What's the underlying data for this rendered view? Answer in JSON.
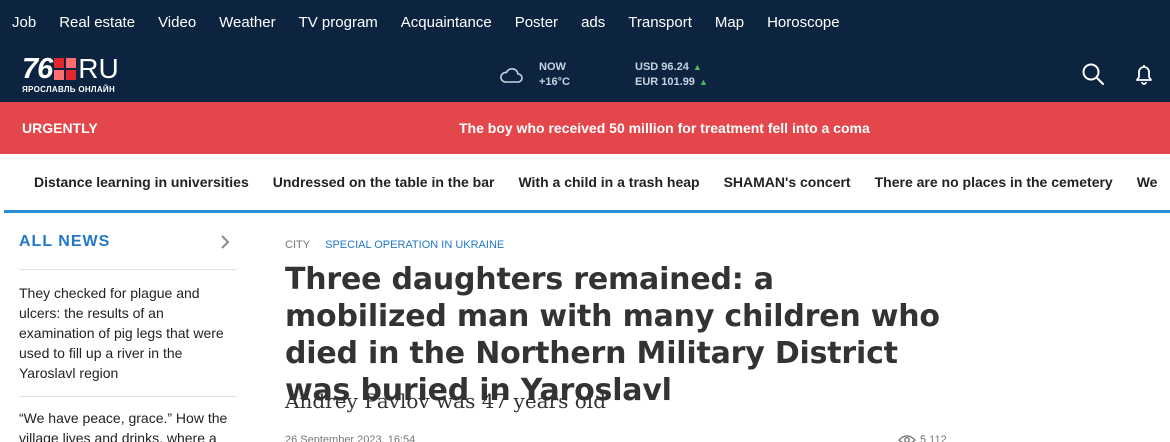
{
  "topnav": [
    "Job",
    "Real estate",
    "Video",
    "Weather",
    "TV program",
    "Acquaintance",
    "Poster",
    "ads",
    "Transport",
    "Map",
    "Horoscope"
  ],
  "logo": {
    "number": "76",
    "suffix": "RU",
    "subtitle": "ЯРОСЛАВЛЬ ОНЛАЙН"
  },
  "weather": {
    "label": "NOW",
    "temp": "+16°C",
    "icon": "cloud-icon"
  },
  "currency": {
    "usd": "USD 96.24",
    "eur": "EUR 101.99"
  },
  "urgent": {
    "label": "URGENTLY",
    "text": "The boy who received 50 million for treatment fell into a coma"
  },
  "topics": [
    "Distance learning in universities",
    "Undressed on the table in the bar",
    "With a child in a trash heap",
    "SHAMAN's concert",
    "There are no places in the cemetery",
    "We"
  ],
  "sidebar": {
    "title": "ALL NEWS",
    "items": [
      "They checked for plague and ulcers: the results of an examination of pig legs that were used to fill up a river in the Yaroslavl region",
      "“We have peace, grace.” How the village lives and drinks, where a"
    ]
  },
  "article": {
    "category": "CITY",
    "rubric": "SPECIAL OPERATION IN UKRAINE",
    "title": "Three daughters remained: a mobilized man with many children who died in the Northern Military District was buried in Yaroslavl",
    "subtitle": "Andrey Pavlov was 47 years old",
    "date": "26 September 2023, 16:54",
    "views": "5 112"
  },
  "colors": {
    "nav_bg": "#0d2440",
    "urgent_bg": "#e4474b",
    "accent": "#2478c9",
    "logo_red": "#e4262f"
  }
}
